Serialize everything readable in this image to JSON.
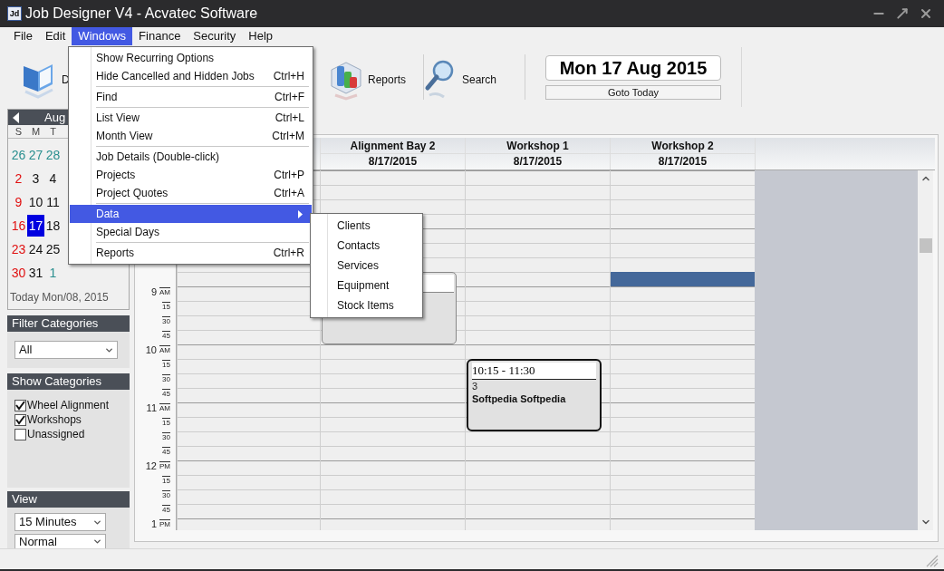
{
  "window": {
    "title": "Job Designer V4 - Acvatec Software",
    "logo_text": "Jd"
  },
  "menu_bar": [
    {
      "label": "File",
      "selected": false
    },
    {
      "label": "Edit",
      "selected": false
    },
    {
      "label": "Windows",
      "selected": true
    },
    {
      "label": "Finance",
      "selected": false
    },
    {
      "label": "Security",
      "selected": false
    },
    {
      "label": "Help",
      "selected": false
    }
  ],
  "toolbar": {
    "buttons": [
      {
        "label": "D",
        "kind": "book"
      },
      {
        "label": "Reports",
        "kind": "chart"
      },
      {
        "label": "Search",
        "kind": "search"
      }
    ],
    "date": "Mon 17 Aug 2015",
    "goto_button": "Goto Today"
  },
  "mini_calendar": {
    "month": "Aug",
    "weekdays": [
      "S",
      "M",
      "T"
    ],
    "weeks": [
      [
        {
          "day": "26",
          "kind": "other",
          "selected": false
        },
        {
          "day": "27",
          "kind": "other",
          "selected": false
        },
        {
          "day": "28",
          "kind": "other",
          "selected": false
        }
      ],
      [
        {
          "day": "2",
          "kind": "sunday",
          "selected": false
        },
        {
          "day": "3",
          "kind": "normal",
          "selected": false
        },
        {
          "day": "4",
          "kind": "normal",
          "selected": false
        }
      ],
      [
        {
          "day": "9",
          "kind": "sunday",
          "selected": false
        },
        {
          "day": "10",
          "kind": "normal",
          "selected": false
        },
        {
          "day": "11",
          "kind": "normal",
          "selected": false
        }
      ],
      [
        {
          "day": "16",
          "kind": "sunday",
          "selected": false
        },
        {
          "day": "17",
          "kind": "normal",
          "selected": true
        },
        {
          "day": "18",
          "kind": "normal",
          "selected": false
        }
      ],
      [
        {
          "day": "23",
          "kind": "sunday",
          "selected": false
        },
        {
          "day": "24",
          "kind": "normal",
          "selected": false
        },
        {
          "day": "25",
          "kind": "normal",
          "selected": false
        }
      ],
      [
        {
          "day": "30",
          "kind": "sunday",
          "selected": false
        },
        {
          "day": "31",
          "kind": "normal",
          "selected": false
        },
        {
          "day": "1",
          "kind": "other",
          "selected": false
        }
      ]
    ],
    "today_text": "Today Mon/08, 2015"
  },
  "filter_categories": {
    "title": "Filter Categories",
    "value": "All"
  },
  "show_categories": {
    "title": "Show Categories",
    "items": [
      {
        "label": "Wheel Alignment",
        "checked": true
      },
      {
        "label": "Workshops",
        "checked": true
      },
      {
        "label": "Unassigned",
        "checked": false
      }
    ]
  },
  "view": {
    "title": "View",
    "selects": [
      "15 Minutes",
      "Normal"
    ]
  },
  "scheduler": {
    "resources": [
      {
        "name": "Alignment Bay 2",
        "date": "8/17/2015",
        "selection": false,
        "appointments": [
          {
            "kind": "blank"
          }
        ]
      },
      {
        "name": "Workshop 1",
        "date": "8/17/2015",
        "selection": false,
        "appointments": [
          {
            "kind": "job",
            "time": "10:15 - 11:30",
            "number": "3",
            "client": "Softpedia Softpedia"
          }
        ]
      },
      {
        "name": "Workshop 2",
        "date": "8/17/2015",
        "selection": true
      }
    ],
    "time_slots": [
      {
        "label": "9",
        "period": "AM"
      },
      {
        "label": "15"
      },
      {
        "label": "30"
      },
      {
        "label": "45"
      },
      {
        "label": "10",
        "period": "AM"
      },
      {
        "label": "15"
      },
      {
        "label": "30"
      },
      {
        "label": "45"
      },
      {
        "label": "11",
        "period": "AM"
      },
      {
        "label": "15"
      },
      {
        "label": "30"
      },
      {
        "label": "45"
      },
      {
        "label": "12",
        "period": "PM"
      },
      {
        "label": "15"
      },
      {
        "label": "30"
      },
      {
        "label": "45"
      },
      {
        "label": "1",
        "period": "PM"
      }
    ]
  },
  "windows_menu": {
    "groups": [
      [
        {
          "label": "Show Recurring Options",
          "kind": "command",
          "selected": false
        },
        {
          "label": "Hide Cancelled and Hidden Jobs",
          "shortcut": "Ctrl+H",
          "kind": "command",
          "selected": false
        }
      ],
      [
        {
          "label": "Find",
          "shortcut": "Ctrl+F",
          "kind": "command",
          "selected": false
        }
      ],
      [
        {
          "label": "List View",
          "shortcut": "Ctrl+L",
          "kind": "command",
          "selected": false
        },
        {
          "label": "Month View",
          "shortcut": "Ctrl+M",
          "kind": "command",
          "selected": false
        }
      ],
      [
        {
          "label": "Job Details (Double-click)",
          "kind": "command",
          "selected": false
        },
        {
          "label": "Projects",
          "shortcut": "Ctrl+P",
          "kind": "command",
          "selected": false
        },
        {
          "label": "Project Quotes",
          "shortcut": "Ctrl+A",
          "kind": "command",
          "selected": false
        }
      ],
      [
        {
          "label": "Data",
          "kind": "submenu",
          "selected": true
        },
        {
          "label": "Special Days",
          "kind": "command",
          "selected": false
        }
      ],
      [
        {
          "label": "Reports",
          "shortcut": "Ctrl+R",
          "kind": "command",
          "selected": false
        }
      ]
    ]
  },
  "data_submenu": [
    "Clients",
    "Contacts",
    "Services",
    "Equipment",
    "Stock Items"
  ]
}
